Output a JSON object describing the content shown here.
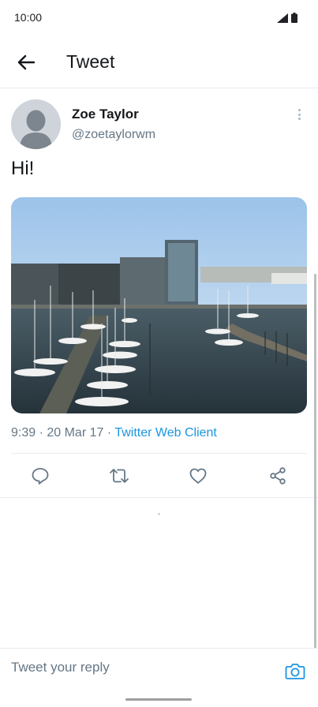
{
  "status_bar": {
    "time": "10:00",
    "icons": [
      "signal-icon",
      "battery-icon"
    ]
  },
  "header": {
    "back_icon": "arrow-left-icon",
    "title": "Tweet"
  },
  "tweet": {
    "author": {
      "name": "Zoe Taylor",
      "handle": "@zoetaylorwm",
      "avatar": "default-avatar-icon"
    },
    "text": "Hi!",
    "photo": "harbor-marina-photo",
    "time": "9:39",
    "separator1": " · ",
    "date": "20 Mar 17",
    "separator2": " · ",
    "client": "Twitter Web Client"
  },
  "actions": [
    "reply-icon",
    "retweet-icon",
    "like-icon",
    "share-icon"
  ],
  "reply": {
    "placeholder": "Tweet your reply",
    "camera_icon": "camera-icon"
  },
  "colors": {
    "accent": "#1b95e0",
    "secondary_text": "#657786",
    "divider": "#e6ecf0"
  }
}
